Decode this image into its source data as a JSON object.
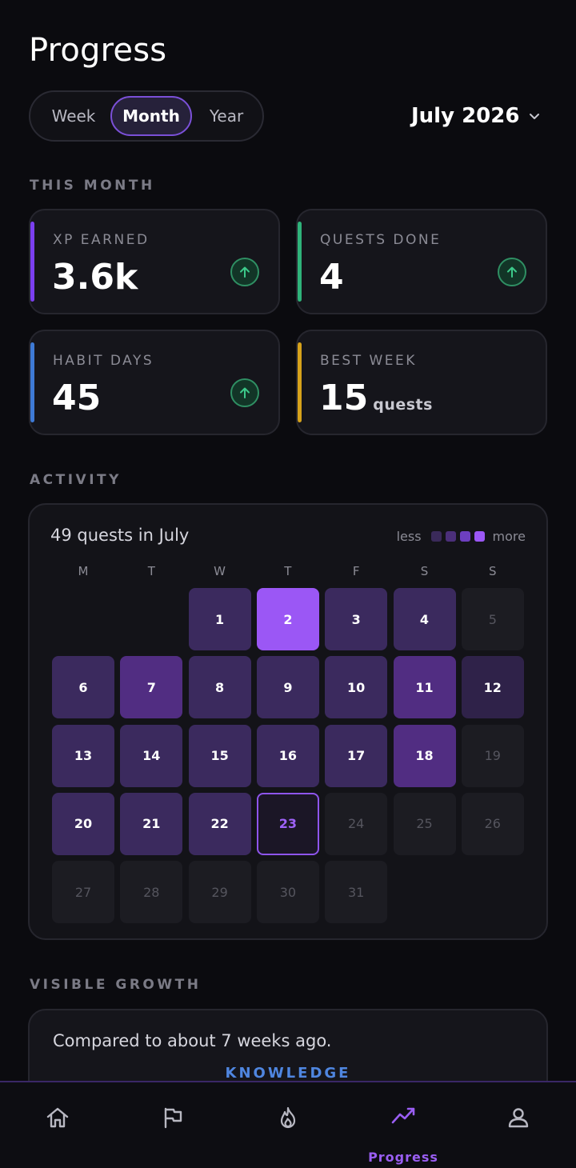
{
  "header": {
    "title": "Progress"
  },
  "range_tabs": {
    "week": "Week",
    "month": "Month",
    "year": "Year",
    "selected": "Month"
  },
  "month_picker": {
    "label": "July 2026"
  },
  "this_month": {
    "heading": "THIS MONTH",
    "cards": [
      {
        "label": "XP EARNED",
        "value": "3.6k",
        "unit": "",
        "accent": "#7b3ff0",
        "trend": "up"
      },
      {
        "label": "QUESTS DONE",
        "value": "4",
        "unit": "",
        "accent": "#2fb37a",
        "trend": "up"
      },
      {
        "label": "HABIT DAYS",
        "value": "45",
        "unit": "",
        "accent": "#3e7ad6",
        "trend": "up"
      },
      {
        "label": "BEST WEEK",
        "value": "15",
        "unit": "quests",
        "accent": "#d6a21b",
        "trend": ""
      }
    ]
  },
  "activity": {
    "heading": "ACTIVITY",
    "summary": "49 quests in July",
    "legend": {
      "less": "less",
      "more": "more",
      "swatches": [
        "#3a2a5a",
        "#4b2f7a",
        "#6d3fc0",
        "#9b57f5"
      ]
    },
    "weekdays": [
      "M",
      "T",
      "W",
      "T",
      "F",
      "S",
      "S"
    ],
    "days": [
      {
        "day": "1",
        "level": "l1"
      },
      {
        "day": "2",
        "level": "max"
      },
      {
        "day": "3",
        "level": "l1"
      },
      {
        "day": "4",
        "level": "l1"
      },
      {
        "day": "5",
        "level": "l0"
      },
      {
        "day": "6",
        "level": "l1"
      },
      {
        "day": "7",
        "level": "l3"
      },
      {
        "day": "8",
        "level": "l1"
      },
      {
        "day": "9",
        "level": "l1"
      },
      {
        "day": "10",
        "level": "l1"
      },
      {
        "day": "11",
        "level": "l3"
      },
      {
        "day": "12",
        "level": "l4"
      },
      {
        "day": "13",
        "level": "l1"
      },
      {
        "day": "14",
        "level": "l1"
      },
      {
        "day": "15",
        "level": "l1"
      },
      {
        "day": "16",
        "level": "l1"
      },
      {
        "day": "17",
        "level": "l1"
      },
      {
        "day": "18",
        "level": "l3"
      },
      {
        "day": "19",
        "level": "l0"
      },
      {
        "day": "20",
        "level": "l1"
      },
      {
        "day": "21",
        "level": "l1"
      },
      {
        "day": "22",
        "level": "l1"
      },
      {
        "day": "23",
        "level": "today"
      },
      {
        "day": "24",
        "level": "l0"
      },
      {
        "day": "25",
        "level": "l0"
      },
      {
        "day": "26",
        "level": "l0"
      },
      {
        "day": "27",
        "level": "l0"
      },
      {
        "day": "28",
        "level": "l0"
      },
      {
        "day": "29",
        "level": "l0"
      },
      {
        "day": "30",
        "level": "l0"
      },
      {
        "day": "31",
        "level": "l0"
      }
    ]
  },
  "visible_growth": {
    "heading": "VISIBLE GROWTH",
    "subtitle": "Compared to about 7 weeks ago.",
    "category": "KNOWLEDGE"
  },
  "nav": {
    "items": [
      {
        "icon": "home-icon"
      },
      {
        "icon": "flag-icon"
      },
      {
        "icon": "flame-icon"
      },
      {
        "icon": "trend-icon",
        "label": "Progress",
        "active": true
      },
      {
        "icon": "profile-icon"
      }
    ]
  }
}
